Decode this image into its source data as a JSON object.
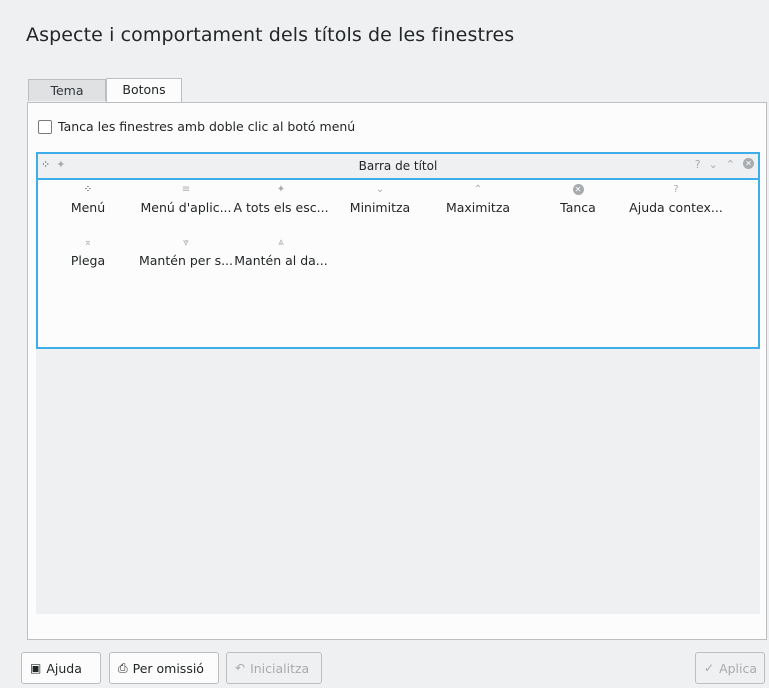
{
  "page": {
    "title": "Aspecte i comportament dels títols de les finestres"
  },
  "tabs": [
    {
      "label": "Tema",
      "active": false
    },
    {
      "label": "Botons",
      "active": true
    }
  ],
  "options": {
    "close_on_double_click": {
      "label": "Tanca les finestres amb doble clic al botó menú",
      "checked": false
    }
  },
  "preview": {
    "titlebar_title": "Barra de títol",
    "left_icons": [
      "menu-icon",
      "pin-icon"
    ],
    "right_icons": [
      "help-icon",
      "minimize-icon",
      "maximize-icon",
      "close-icon"
    ]
  },
  "available_buttons": [
    {
      "label": "Menú",
      "icon": "menu-icon"
    },
    {
      "label": "Menú d'aplic...",
      "icon": "app-menu-icon"
    },
    {
      "label": "A tots els esc...",
      "icon": "pin-icon"
    },
    {
      "label": "Minimitza",
      "icon": "minimize-icon"
    },
    {
      "label": "Maximitza",
      "icon": "maximize-icon"
    },
    {
      "label": "Tanca",
      "icon": "close-icon"
    },
    {
      "label": "Ajuda contex...",
      "icon": "help-icon"
    },
    {
      "label": "Plega",
      "icon": "shade-icon"
    },
    {
      "label": "Mantén per s...",
      "icon": "keep-below-icon"
    },
    {
      "label": "Mantén al da...",
      "icon": "keep-above-icon"
    }
  ],
  "footer": {
    "help": "Ajuda",
    "defaults": "Per omissió",
    "reset": "Inicialitza",
    "apply": "Aplica"
  },
  "colors": {
    "accent": "#3daee9",
    "background": "#eff0f1",
    "panel": "#fcfcfc"
  }
}
